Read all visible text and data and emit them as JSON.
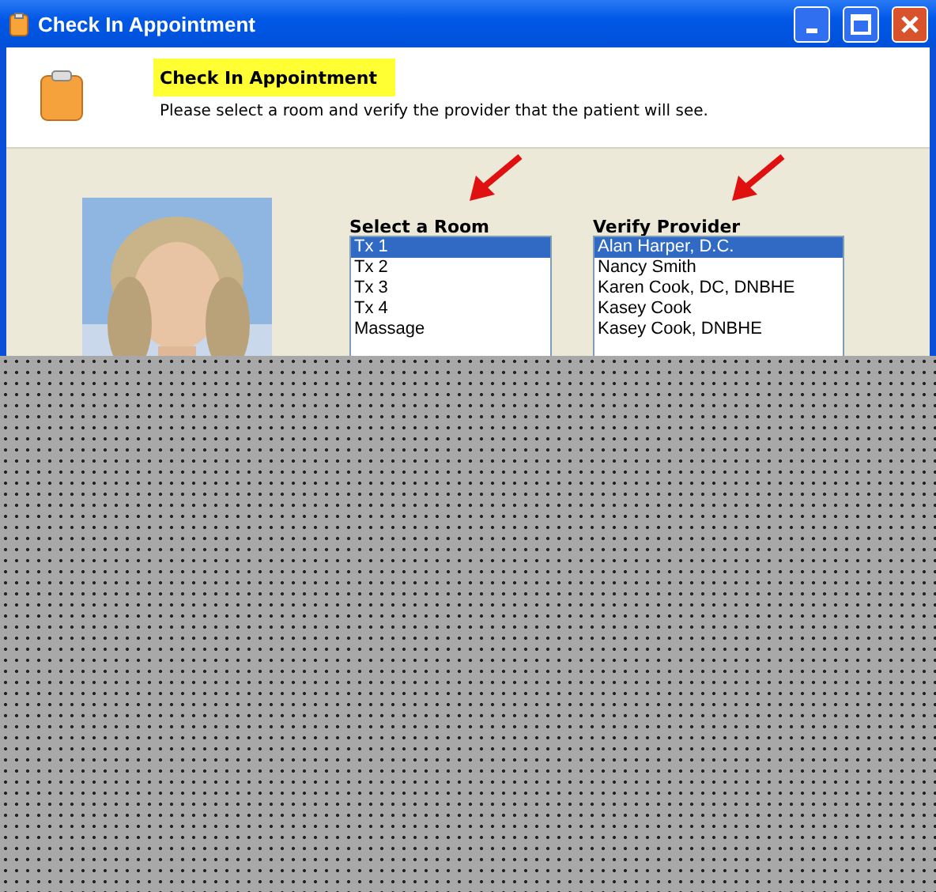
{
  "window": {
    "title": "Check In Appointment"
  },
  "header": {
    "title": "Check In Appointment",
    "subtitle": "Please select a room and verify the provider that the patient will see."
  },
  "room_list": {
    "label": "Select a Room",
    "items": [
      {
        "label": "Tx 1",
        "selected": true
      },
      {
        "label": "Tx 2",
        "selected": false
      },
      {
        "label": "Tx 3",
        "selected": false
      },
      {
        "label": "Tx 4",
        "selected": false
      },
      {
        "label": "Massage",
        "selected": false
      }
    ]
  },
  "provider_list": {
    "label": "Verify Provider",
    "items": [
      {
        "label": "Alan Harper, D.C.",
        "selected": true
      },
      {
        "label": "Nancy Smith",
        "selected": false
      },
      {
        "label": "Karen Cook, DC, DNBHE",
        "selected": false
      },
      {
        "label": "Kasey Cook",
        "selected": false
      },
      {
        "label": "Kasey Cook, DNBHE",
        "selected": false
      }
    ]
  }
}
